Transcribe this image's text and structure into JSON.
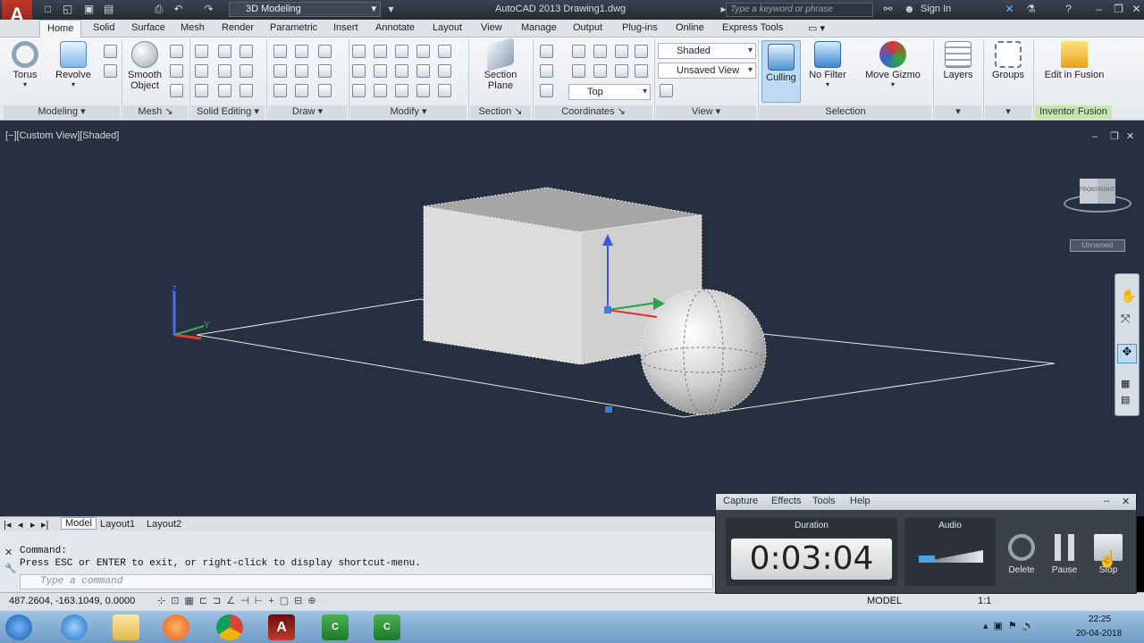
{
  "window": {
    "title": "AutoCAD 2013   Drawing1.dwg",
    "workspace": "3D Modeling",
    "search_placeholder": "Type a keyword or phrase",
    "sign_in": "Sign In"
  },
  "tabs": [
    "Home",
    "Solid",
    "Surface",
    "Mesh",
    "Render",
    "Parametric",
    "Insert",
    "Annotate",
    "Layout",
    "View",
    "Manage",
    "Output",
    "Plug-ins",
    "Online",
    "Express Tools"
  ],
  "ribbon": {
    "buttons": {
      "torus": "Torus",
      "revolve": "Revolve",
      "smooth_object_1": "Smooth",
      "smooth_object_2": "Object",
      "section_plane_1": "Section",
      "section_plane_2": "Plane",
      "culling": "Culling",
      "no_filter": "No Filter",
      "move_gizmo": "Move Gizmo",
      "layers": "Layers",
      "groups": "Groups",
      "edit_in_fusion": "Edit in Fusion"
    },
    "dropdowns": {
      "visual_style": "Shaded",
      "view_name": "Unsaved View",
      "view_direction": "Top"
    },
    "panels": [
      "Modeling",
      "Mesh",
      "Solid Editing",
      "Draw",
      "Modify",
      "Section",
      "Coordinates",
      "View",
      "Selection",
      "Inventor Fusion"
    ]
  },
  "viewport": {
    "label": "[−][Custom View][Shaded]",
    "viewcube_label": "Unnamed",
    "viewcube_faces": [
      "FRONT",
      "RIGHT"
    ],
    "ucs_axes": [
      "Z",
      "Y"
    ]
  },
  "layout_tabs": [
    "Model",
    "Layout1",
    "Layout2"
  ],
  "command": {
    "history": [
      "Command:",
      "Press ESC or ENTER to exit, or right-click to display shortcut-menu."
    ],
    "placeholder": "Type a command"
  },
  "status": {
    "coords": "487.2604, -163.1049, 0.0000",
    "model": "MODEL",
    "scale": "1:1"
  },
  "recorder": {
    "menu": [
      "Capture",
      "Effects",
      "Tools",
      "Help"
    ],
    "duration_label": "Duration",
    "duration": "0:03:04",
    "audio_label": "Audio",
    "audio_level": 0.25,
    "delete": "Delete",
    "pause": "Pause",
    "stop": "Stop"
  },
  "taskbar": {
    "time": "22:25",
    "date": "20-04-2018"
  },
  "colors": {
    "viewport_bg": "#263040",
    "ribbon_bg": "#e6e9ed",
    "titlebar_bg": "#2f3640",
    "taskbar_bg": "#7fa9cf"
  }
}
